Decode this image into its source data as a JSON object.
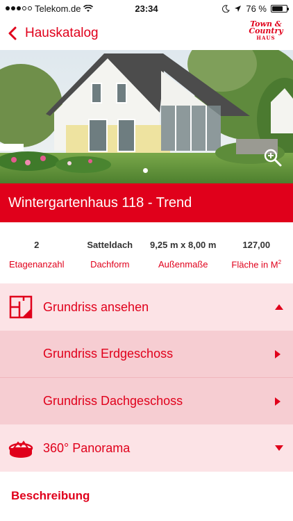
{
  "status_bar": {
    "carrier": "Telekom.de",
    "time": "23:34",
    "battery_percent": "76 %",
    "battery_level": 0.76,
    "signal_filled": 3,
    "signal_total": 5
  },
  "nav": {
    "back_label": "Hauskatalog",
    "logo": {
      "line1": "Town &",
      "line2": "Country",
      "line3": "HAUS"
    }
  },
  "hero": {
    "image_icon": "house-photo",
    "zoom_icon": "zoom-in-icon",
    "page_indicator_count": 1
  },
  "title": "Wintergartenhaus 118 - Trend",
  "specs": [
    {
      "value": "2",
      "label": "Etagenanzahl"
    },
    {
      "value": "Satteldach",
      "label": "Dachform"
    },
    {
      "value": "9,25 m x 8,00 m",
      "label": "Außenmaße"
    },
    {
      "value": "127,00",
      "label": "Fläche in M",
      "label_sup": "2"
    }
  ],
  "accordion": {
    "floorplan": {
      "label": "Grundriss ansehen",
      "icon": "floorplan-icon",
      "expanded": true,
      "items": [
        {
          "label": "Grundriss Erdgeschoss"
        },
        {
          "label": "Grundriss Dachgeschoss"
        }
      ]
    },
    "panorama": {
      "label": "360° Panorama",
      "icon": "panorama-360-icon",
      "expanded": false
    }
  },
  "description_heading": "Beschreibung",
  "colors": {
    "brand_red": "#e0001b",
    "header_bg": "#fce3e6",
    "subitem_bg": "#f6cdd2"
  }
}
